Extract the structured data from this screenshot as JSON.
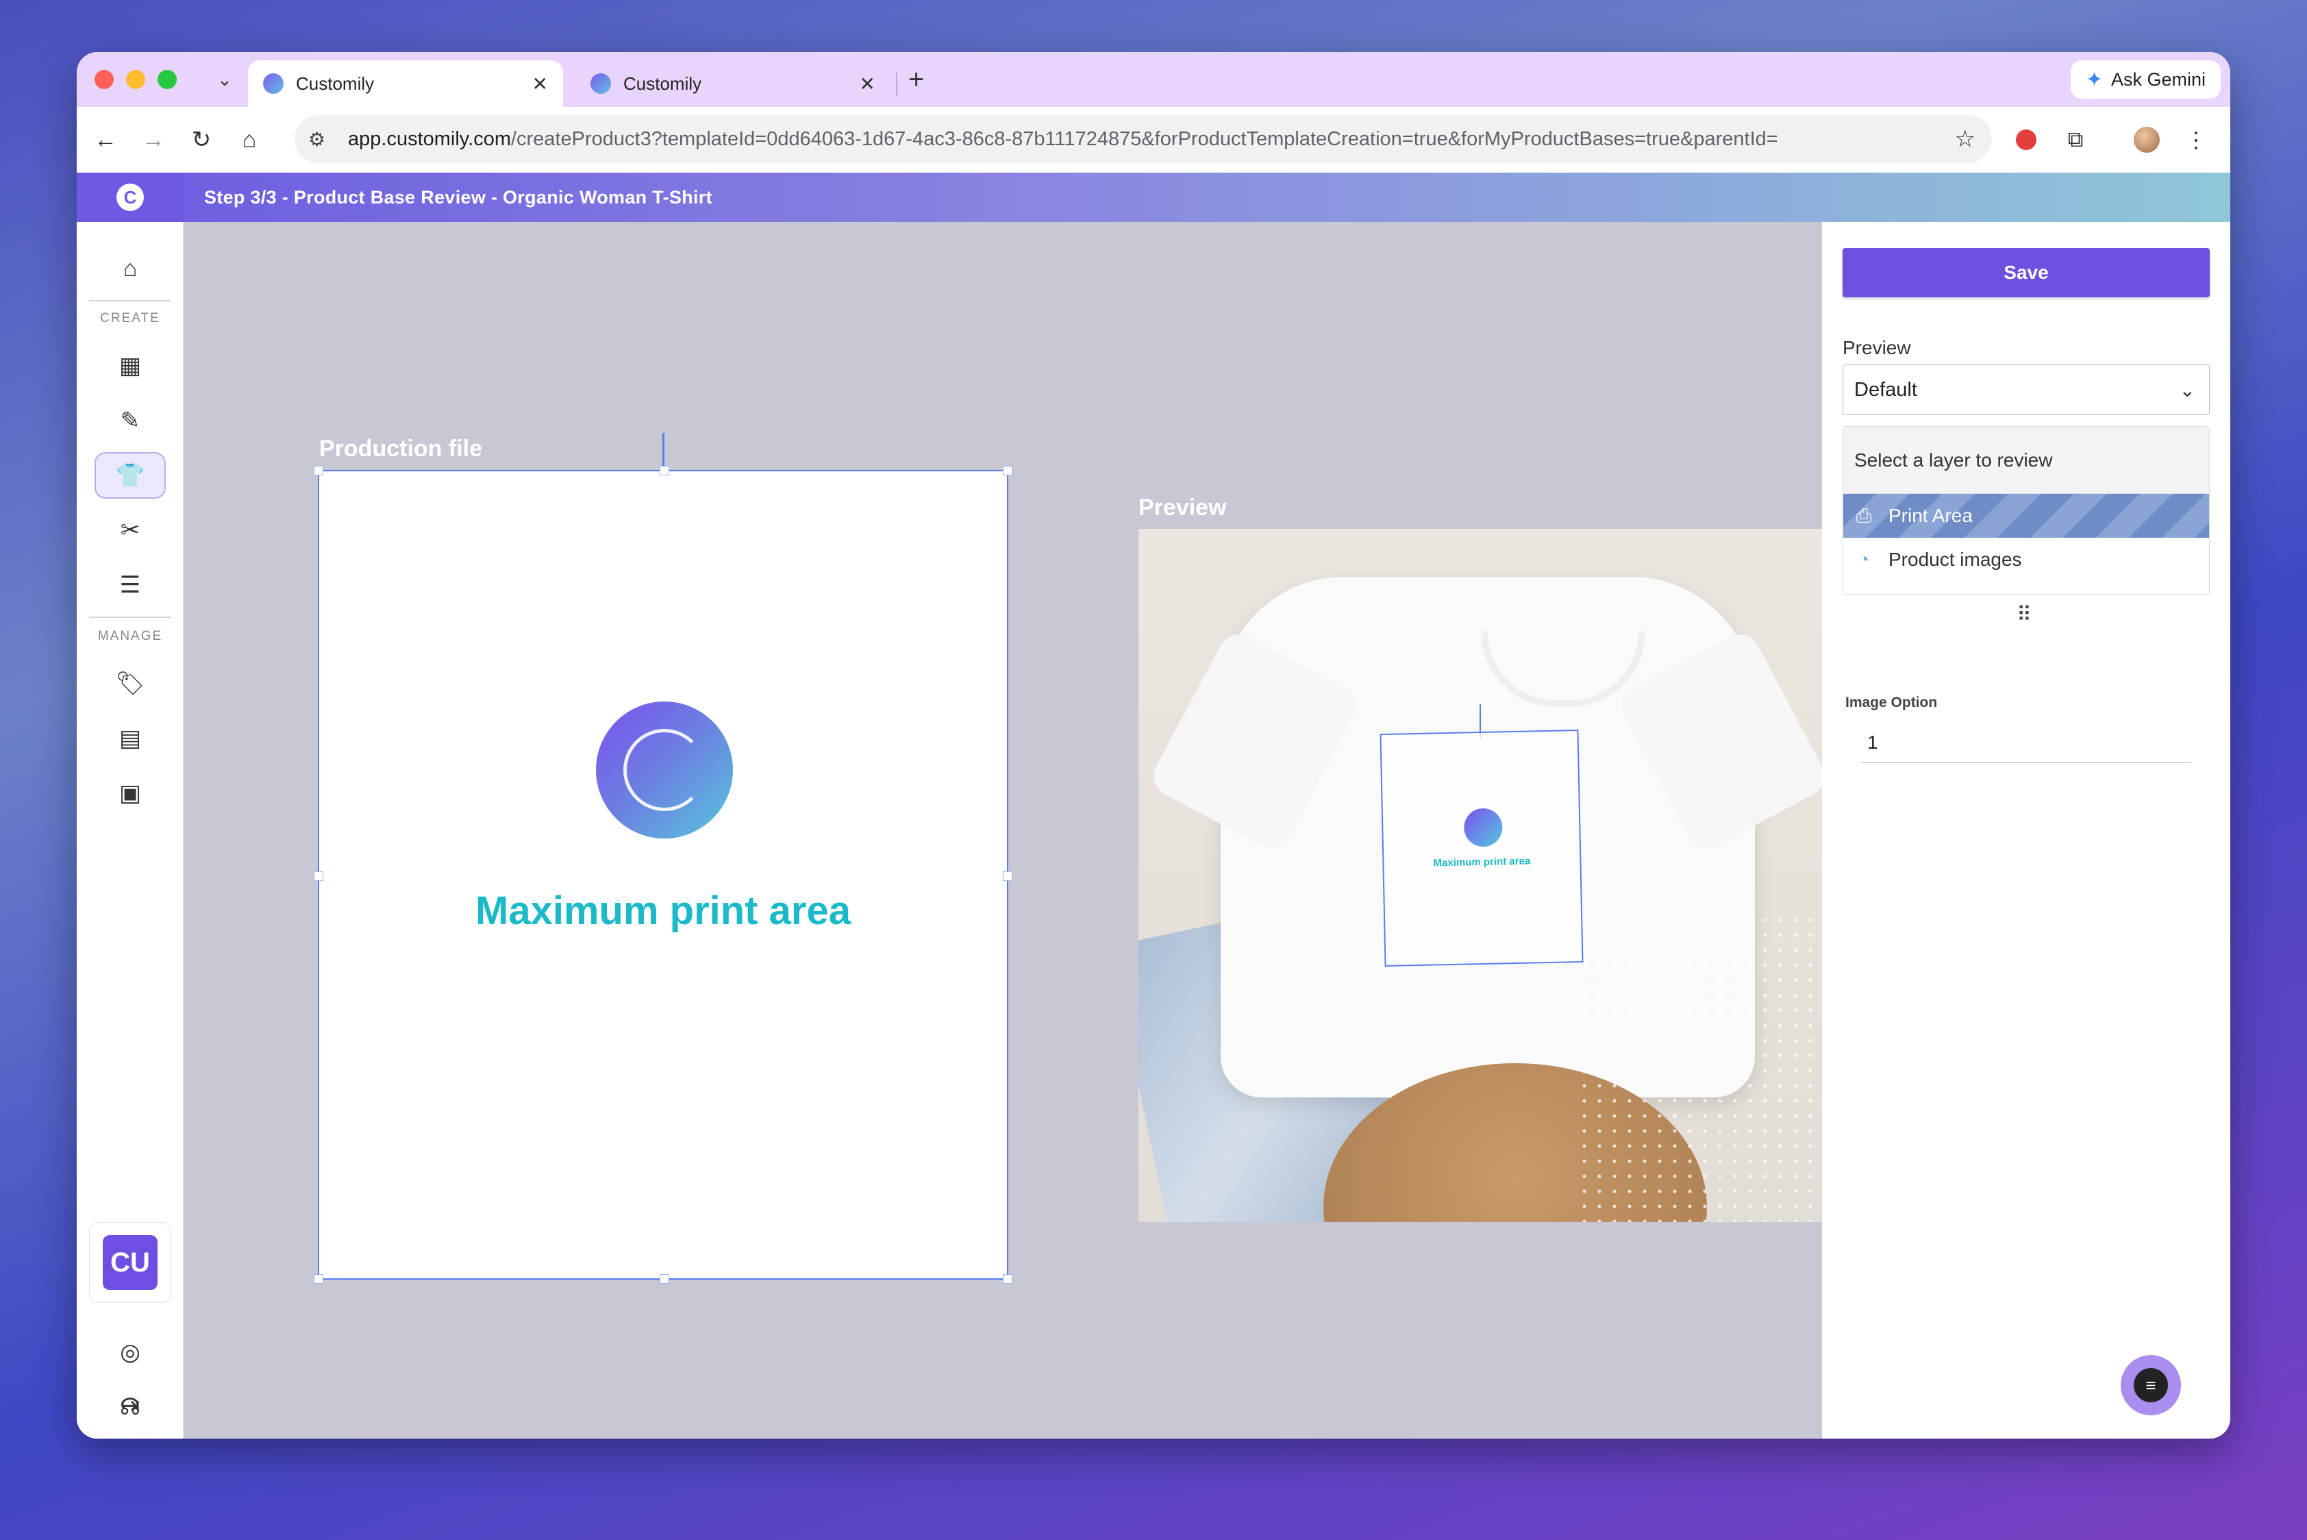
{
  "browser": {
    "tabs": [
      {
        "title": "Customily"
      },
      {
        "title": "Customily"
      }
    ],
    "gemini_label": "Ask Gemini",
    "url_host": "app.customily.com",
    "url_path": "/createProduct3?templateId=0dd64063-1d67-4ac3-86c8-87b111724875&forProductTemplateCreation=true&forMyProductBases=true&parentId="
  },
  "app": {
    "step_title": "Step 3/3 - Product Base Review - Organic Woman T-Shirt",
    "sidebar": {
      "create_label": "CREATE",
      "manage_label": "MANAGE",
      "user_initials": "CU"
    }
  },
  "canvas": {
    "production_label": "Production file",
    "preview_label": "Preview",
    "print_area_text": "Maximum print area",
    "mockup_print_text": "Maximum print area"
  },
  "panel": {
    "save_label": "Save",
    "preview_label": "Preview",
    "preview_selected": "Default",
    "layers_header": "Select a layer to review",
    "layers": [
      {
        "label": "Print Area",
        "icon": "printer-icon",
        "selected": true
      },
      {
        "label": "Product images",
        "icon": "palette-icon",
        "selected": false
      }
    ],
    "image_option_label": "Image Option",
    "image_option_value": "1"
  },
  "colors": {
    "accent": "#6e50e0",
    "print_text": "#1cbac8",
    "frame": "#5a7cf0"
  }
}
